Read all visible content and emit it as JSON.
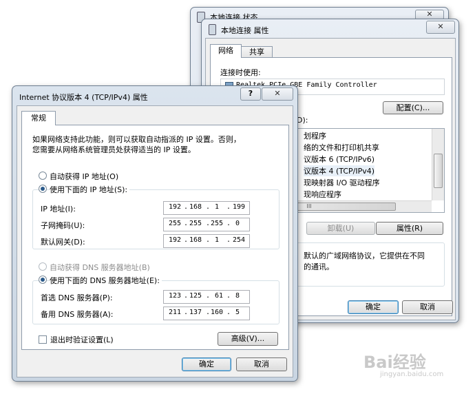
{
  "back_window": {
    "title": "本地连接 状态",
    "close_label": "✕"
  },
  "mid_window": {
    "title": "本地连接 属性",
    "close_label": "✕",
    "tabs": [
      {
        "label": "网络"
      },
      {
        "label": "共享"
      }
    ],
    "connect_using_label": "连接时使用:",
    "adapter_name": "Realtek PCIe GBE Family Controller",
    "configure_button": "配置(C)...",
    "items_label_fragment": "D):",
    "items": [
      {
        "label": "划程序"
      },
      {
        "label": "络的文件和打印机共享"
      },
      {
        "label": "议版本 6 (TCP/IPv6)"
      },
      {
        "label": "议版本 4 (TCP/IPv4)"
      },
      {
        "label": "现映射器 I/O 驱动程序"
      },
      {
        "label": "现响应程序"
      }
    ],
    "hscroll_label": "III",
    "uninstall_button": "卸载(U)",
    "properties_button": "属性(R)",
    "description_line1": "默认的广域网络协议，它提供在不同",
    "description_line2": "的通讯。",
    "ok_button": "确定",
    "cancel_button": "取消"
  },
  "front_window": {
    "title": "Internet 协议版本 4 (TCP/IPv4) 属性",
    "help_label": "?",
    "close_label": "✕",
    "tab_general": "常规",
    "intro_line1": "如果网络支持此功能，则可以获取自动指派的 IP 设置。否则，",
    "intro_line2": "您需要从网络系统管理员处获得适当的 IP 设置。",
    "auto_ip_label": "自动获得 IP 地址(O)",
    "manual_ip_label": "使用下面的 IP 地址(S):",
    "ip_label": "IP 地址(I):",
    "ip_value": [
      "192",
      "168",
      "1",
      "199"
    ],
    "mask_label": "子网掩码(U):",
    "mask_value": [
      "255",
      "255",
      "255",
      "0"
    ],
    "gateway_label": "默认网关(D):",
    "gateway_value": [
      "192",
      "168",
      "1",
      "254"
    ],
    "auto_dns_label": "自动获得 DNS 服务器地址(B)",
    "manual_dns_label": "使用下面的 DNS 服务器地址(E):",
    "dns1_label": "首选 DNS 服务器(P):",
    "dns1_value": [
      "123",
      "125",
      "61",
      "8"
    ],
    "dns2_label": "备用 DNS 服务器(A):",
    "dns2_value": [
      "211",
      "137",
      "160",
      "5"
    ],
    "validate_label": "退出时验证设置(L)",
    "advanced_button": "高级(V)...",
    "ok_button": "确定",
    "cancel_button": "取消"
  },
  "watermark": {
    "text": "Bai经验",
    "subtext": "jingyan.baidu.com"
  }
}
